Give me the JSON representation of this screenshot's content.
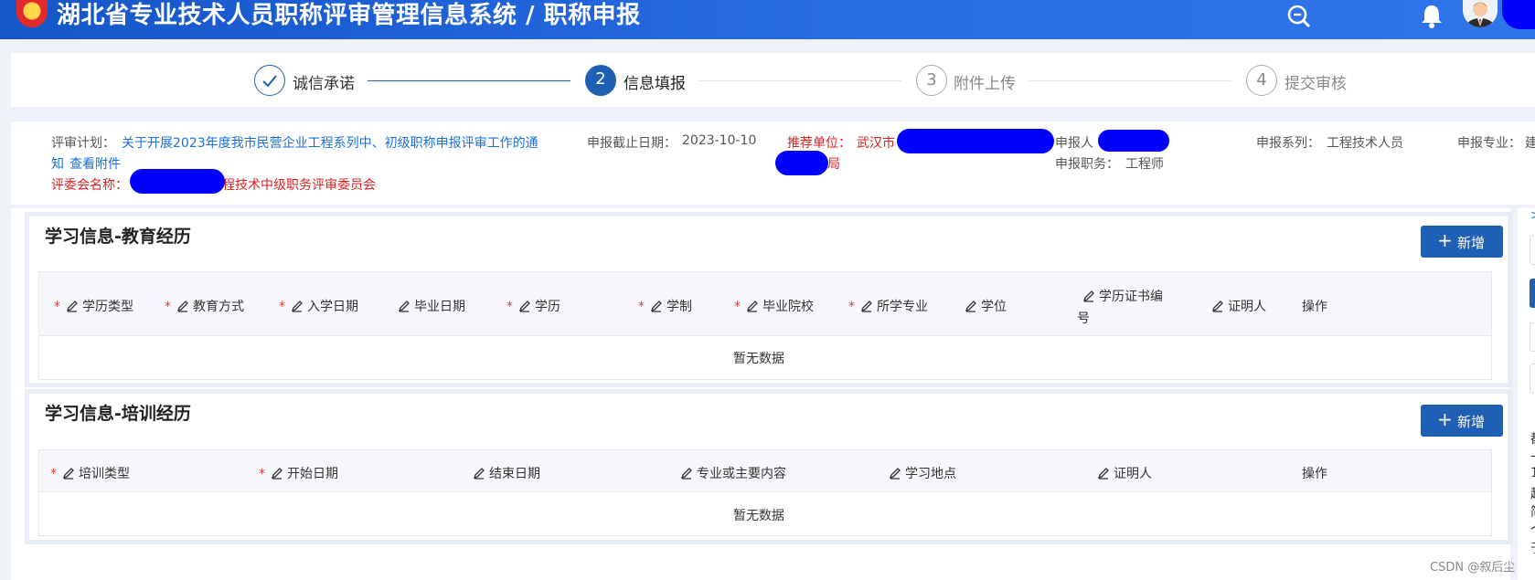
{
  "header": {
    "title": "湖北省专业技术人员职称评审管理信息系统 / 职称申报",
    "icons": [
      "search-icon",
      "bell-icon",
      "avatar"
    ]
  },
  "steps": [
    {
      "number": "",
      "label": "诚信承诺",
      "state": "done"
    },
    {
      "number": "2",
      "label": "信息填报",
      "state": "active"
    },
    {
      "number": "3",
      "label": "附件上传",
      "state": "pending"
    },
    {
      "number": "4",
      "label": "提交审核",
      "state": "pending"
    }
  ],
  "info": {
    "plan_label": "评审计划：",
    "plan_text_1": "关于开展2023年度我市民营企业工程系列中、初级职称申报评审工作的通",
    "plan_text_2": "知",
    "view_attachment": "查看附件",
    "deadline_label": "申报截止日期：",
    "deadline_value": "2023-10-10",
    "recommend_label": "推荐单位：",
    "recommend_value": "武汉市",
    "recommend_value_2": "局",
    "applicant_label": "申报人",
    "series_label": "申报系列：",
    "series_value": "工程技术人员",
    "major_label": "申报专业：",
    "major_value": "建",
    "position_label": "申报职务：",
    "position_value": "工程师",
    "committee_label": "评委会名称：",
    "committee_value": "程技术中级职务评审委员会"
  },
  "education": {
    "title": "学习信息-教育经历",
    "add_label": "新增",
    "columns": [
      {
        "label": "学历类型",
        "required": "*"
      },
      {
        "label": "教育方式",
        "required": "*"
      },
      {
        "label": "入学日期",
        "required": "*"
      },
      {
        "label": "毕业日期",
        "required": ""
      },
      {
        "label": "学历",
        "required": "*"
      },
      {
        "label": "学制",
        "required": "*"
      },
      {
        "label": "毕业院校",
        "required": "*"
      },
      {
        "label": "所学专业",
        "required": "*"
      },
      {
        "label": "学位",
        "required": ""
      },
      {
        "label": "学历证书编",
        "label_2": "号",
        "required": ""
      },
      {
        "label": "证明人",
        "required": ""
      },
      {
        "label": "操作",
        "required": ""
      }
    ],
    "empty_text": "暂无数据"
  },
  "training": {
    "title": "学习信息-培训经历",
    "add_label": "新增",
    "columns": [
      {
        "label": "培训类型",
        "required": "*"
      },
      {
        "label": "开始日期",
        "required": "*"
      },
      {
        "label": "结束日期",
        "required": ""
      },
      {
        "label": "专业或主要内容",
        "required": ""
      },
      {
        "label": "学习地点",
        "required": ""
      },
      {
        "label": "证明人",
        "required": ""
      },
      {
        "label": "操作",
        "required": ""
      }
    ],
    "empty_text": "暂无数据"
  },
  "right_panel": {
    "top_text": ">",
    "chars": [
      "都",
      "一",
      "1",
      "起",
      "简",
      "个",
      "于"
    ]
  },
  "watermark": "CSDN @叙后尘",
  "colors": {
    "header_blue": "#1f63d8",
    "primary": "#1f5fb4",
    "required": "#e23a3a",
    "link": "#1a6fd9"
  }
}
